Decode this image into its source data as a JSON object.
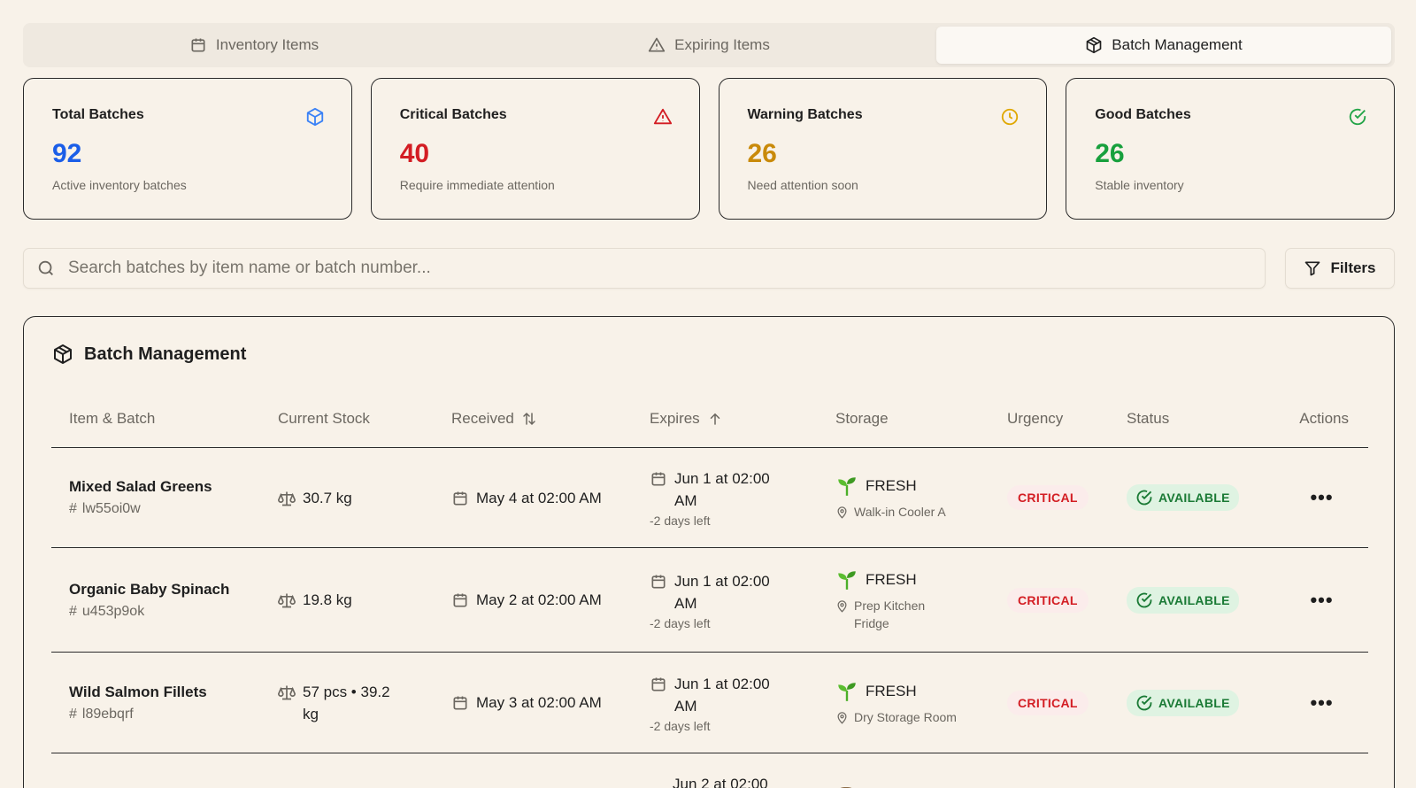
{
  "tabs": [
    {
      "label": "Inventory Items",
      "icon": "calendar-box-icon",
      "active": false
    },
    {
      "label": "Expiring Items",
      "icon": "warning-icon",
      "active": false
    },
    {
      "label": "Batch Management",
      "icon": "package-icon",
      "active": true
    }
  ],
  "cards": [
    {
      "title": "Total Batches",
      "value": "92",
      "desc": "Active inventory batches",
      "color": "#1b5ee8",
      "icon": "package-icon"
    },
    {
      "title": "Critical Batches",
      "value": "40",
      "desc": "Require immediate attention",
      "color": "#d31d23",
      "icon": "warning-icon"
    },
    {
      "title": "Warning Batches",
      "value": "26",
      "desc": "Need attention soon",
      "color": "#c98a0a",
      "icon": "clock-icon"
    },
    {
      "title": "Good Batches",
      "value": "26",
      "desc": "Stable inventory",
      "color": "#18a03d",
      "icon": "check-circle-icon"
    }
  ],
  "search": {
    "placeholder": "Search batches by item name or batch number...",
    "value": ""
  },
  "filters_label": "Filters",
  "panel": {
    "title": "Batch Management"
  },
  "columns": [
    "Item & Batch",
    "Current Stock",
    "Received",
    "Expires",
    "Storage",
    "Urgency",
    "Status",
    "Actions"
  ],
  "rows": [
    {
      "name": "Mixed Salad Greens",
      "batch": "lw55oi0w",
      "stock": "30.7 kg",
      "received": "May 4 at 02:00 AM",
      "expires": "Jun 1 at 02:00 AM",
      "days_left": "-2 days left",
      "storage_type": "FRESH",
      "location": "Walk-in Cooler A",
      "urgency": "CRITICAL",
      "status": "AVAILABLE"
    },
    {
      "name": "Organic Baby Spinach",
      "batch": "u453p9ok",
      "stock": "19.8 kg",
      "received": "May 2 at 02:00 AM",
      "expires": "Jun 1 at 02:00 AM",
      "days_left": "-2 days left",
      "storage_type": "FRESH",
      "location": "Prep Kitchen Fridge",
      "urgency": "CRITICAL",
      "status": "AVAILABLE"
    },
    {
      "name": "Wild Salmon Fillets",
      "batch": "l89ebqrf",
      "stock": "57 pcs • 39.2 kg",
      "received": "May 3 at 02:00 AM",
      "expires": "Jun 1 at 02:00 AM",
      "days_left": "-2 days left",
      "storage_type": "FRESH",
      "location": "Dry Storage Room",
      "urgency": "CRITICAL",
      "status": "AVAILABLE"
    },
    {
      "name": "",
      "batch": "",
      "stock": "",
      "received": "",
      "expires": "Jun 2 at 02:00",
      "days_left": "",
      "storage_type": "",
      "location": "",
      "urgency": "",
      "status": ""
    }
  ],
  "more_glyph": "•••"
}
